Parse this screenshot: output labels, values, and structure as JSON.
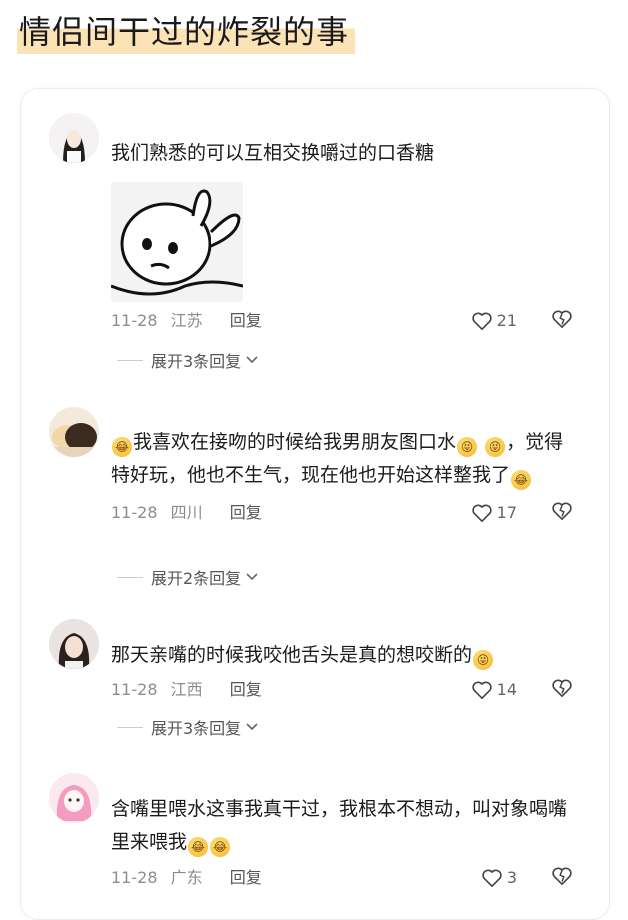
{
  "page": {
    "title": "情侣间干过的炸裂的事"
  },
  "comments": [
    {
      "text": "我们熟悉的可以互相交换嚼过的口香糖",
      "date": "11-28",
      "location": "江苏",
      "reply_label": "回复",
      "likes": "21",
      "expand_label": "展开3条回复"
    },
    {
      "text_parts": [
        "我喜欢在接吻的时候给我男朋友图口水",
        "，觉得特好玩，他也不生气，现在他也开始这样整我了"
      ],
      "date": "11-28",
      "location": "四川",
      "reply_label": "回复",
      "likes": "17",
      "expand_label": "展开2条回复"
    },
    {
      "text": "那天亲嘴的时候我咬他舌头是真的想咬断的",
      "date": "11-28",
      "location": "江西",
      "reply_label": "回复",
      "likes": "14",
      "expand_label": "展开3条回复"
    },
    {
      "text": "含嘴里喂水这事我真干过，我根本不想动，叫对象喝嘴里来喂我",
      "date": "11-28",
      "location": "广东",
      "reply_label": "回复",
      "likes": "3"
    }
  ],
  "icons": {
    "like": "heart-outline-icon",
    "dislike": "broken-heart-icon",
    "expand": "chevron-down-icon",
    "emoji_laugh": "tears-of-joy-emoji",
    "emoji_tongue": "tongue-wink-emoji"
  },
  "colors": {
    "title_highlight": "#fbe3b6",
    "meta_gray": "#8d8d8d"
  }
}
